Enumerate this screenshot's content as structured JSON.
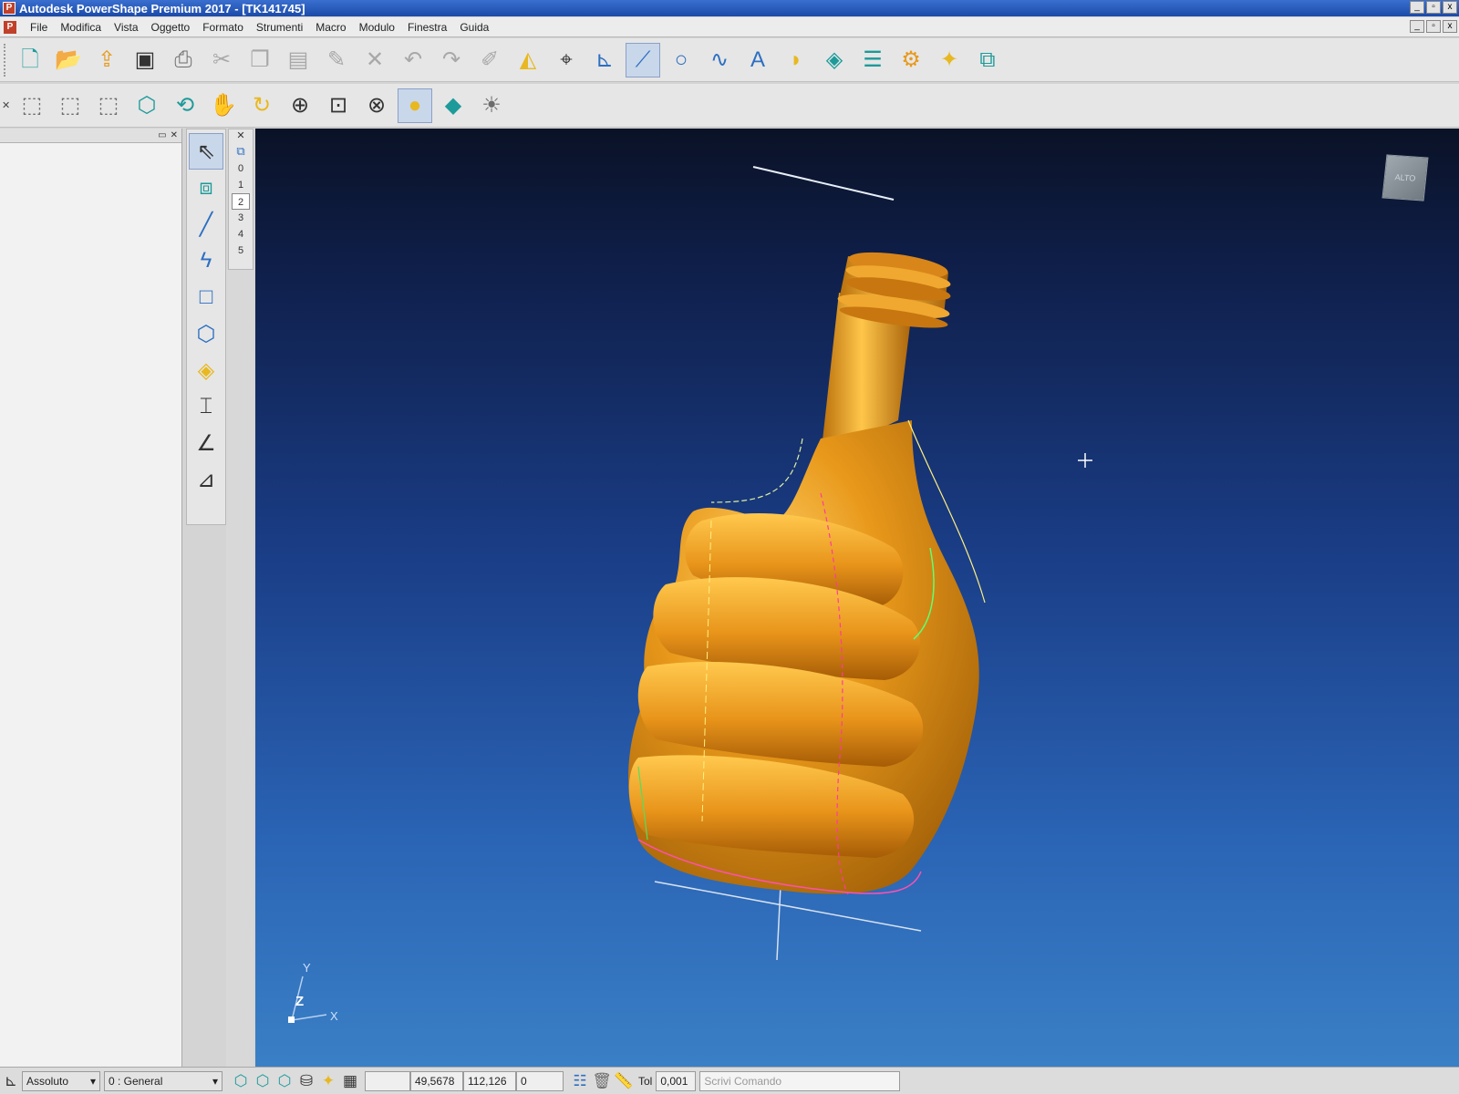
{
  "window": {
    "title": "Autodesk PowerShape Premium 2017 - [TK141745]",
    "app_icon": "P",
    "controls": [
      "_",
      "▫",
      "x"
    ]
  },
  "menu": {
    "items": [
      "File",
      "Modifica",
      "Vista",
      "Oggetto",
      "Formato",
      "Strumenti",
      "Macro",
      "Modulo",
      "Finestra",
      "Guida"
    ]
  },
  "toolbar_main": {
    "icons": [
      "new-file-icon",
      "open-folder-icon",
      "import-icon",
      "save-icon",
      "print-icon",
      "cut-icon",
      "copy-icon",
      "paste-icon",
      "edit-icon",
      "delete-icon",
      "undo-icon",
      "redo-icon",
      "sketch-icon",
      "surface-icon",
      "workplane-icon",
      "axis-icon",
      "line-icon",
      "circle-icon",
      "curve-icon",
      "text-icon",
      "surface-patch-icon",
      "solid-icon",
      "layers-icon",
      "assembly-icon",
      "wizard-icon",
      "toolbox-icon"
    ]
  },
  "toolbar_view": {
    "icons": [
      "view-top-icon",
      "view-front-icon",
      "view-right-icon",
      "view-iso-icon",
      "view-orbit-icon",
      "pan-icon",
      "rotate-icon",
      "zoom-fit-icon",
      "zoom-box-icon",
      "wireframe-icon",
      "shaded-icon",
      "shaded-edges-icon",
      "lights-icon"
    ]
  },
  "side_toolbar": {
    "icons": [
      "select-icon",
      "multi-select-icon",
      "line-icon",
      "polyline-icon",
      "rectangle-icon",
      "polygon-icon",
      "solid-box-icon",
      "dimension-icon",
      "angle-icon",
      "corner-icon"
    ]
  },
  "levels": {
    "items": [
      "0",
      "1",
      "2",
      "3",
      "4",
      "5"
    ],
    "selected": "2"
  },
  "viewport": {
    "view_cube_label": "ALTO",
    "axis": {
      "y": "Y",
      "z": "Z",
      "x": "X"
    },
    "model_color": "#e39418",
    "background_top": "#0a1226",
    "background_bottom": "#3a80c6"
  },
  "statusbar": {
    "coord_mode": "Assoluto",
    "workplane": "0  : General",
    "coord_x": "",
    "coord_y": "49,5678",
    "coord_z": "112,126",
    "value": "0",
    "tol_label": "Tol",
    "tol_value": "0,001",
    "command_placeholder": "Scrivi Comando"
  }
}
